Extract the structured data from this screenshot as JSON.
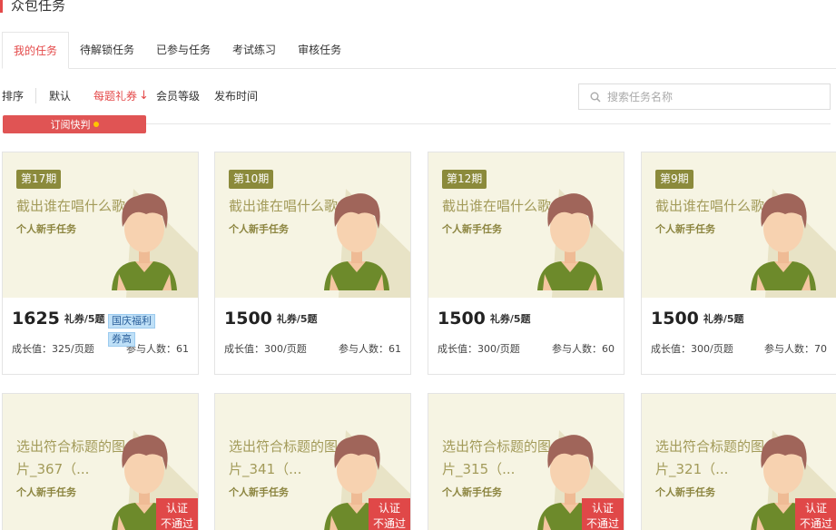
{
  "header": {
    "title": "众包任务"
  },
  "tabs": [
    "我的任务",
    "待解锁任务",
    "已参与任务",
    "考试练习",
    "审核任务"
  ],
  "sort": {
    "label": "排序",
    "items": [
      "默认",
      "每题礼券",
      "会员等级",
      "发布时间"
    ],
    "active_arrow": "↓"
  },
  "search": {
    "placeholder": "搜索任务名称"
  },
  "subscribe": {
    "label": "订阅快判"
  },
  "colors": {
    "accent": "#e44a4a",
    "card_bg": "#f6f4e3",
    "period_bg": "#8b8a3b",
    "badge": "#e04848"
  },
  "cards_top": [
    {
      "period": "第17期",
      "title": "截出谁在唱什么歌",
      "sub": "个人新手任务",
      "price": "1625",
      "unit": "礼券/5题",
      "tags": [
        "国庆福利",
        "券高"
      ],
      "growth": "成长值：325/页题",
      "people": "参与人数：61"
    },
    {
      "period": "第10期",
      "title": "截出谁在唱什么歌",
      "sub": "个人新手任务",
      "price": "1500",
      "unit": "礼券/5题",
      "growth": "成长值：300/页题",
      "people": "参与人数：61"
    },
    {
      "period": "第12期",
      "title": "截出谁在唱什么歌",
      "sub": "个人新手任务",
      "price": "1500",
      "unit": "礼券/5题",
      "growth": "成长值：300/页题",
      "people": "参与人数：60"
    },
    {
      "period": "第9期",
      "title": "截出谁在唱什么歌",
      "sub": "个人新手任务",
      "price": "1500",
      "unit": "礼券/5题",
      "growth": "成长值：300/页题",
      "people": "参与人数：70"
    }
  ],
  "cards_bottom": [
    {
      "title1": "选出符合标题的图",
      "title2": "片_367（...",
      "sub": "个人新手任务",
      "badge1": "认证",
      "badge2": "不通过"
    },
    {
      "title1": "选出符合标题的图",
      "title2": "片_341（...",
      "sub": "个人新手任务",
      "badge1": "认证",
      "badge2": "不通过"
    },
    {
      "title1": "选出符合标题的图",
      "title2": "片_315（...",
      "sub": "个人新手任务",
      "badge1": "认证",
      "badge2": "不通过"
    },
    {
      "title1": "选出符合标题的图",
      "title2": "片_321（...",
      "sub": "个人新手任务",
      "badge1": "认证",
      "badge2": "不通过"
    }
  ]
}
